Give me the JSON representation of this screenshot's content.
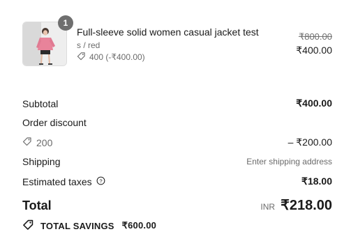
{
  "product": {
    "quantity": "1",
    "title": "Full-sleeve solid women casual jacket test",
    "variant": "s / red",
    "discount": "400 (-₹400.00)",
    "price_original": "₹800.00",
    "price": "₹400.00"
  },
  "summary": {
    "subtotal_label": "Subtotal",
    "subtotal_value": "₹400.00",
    "order_discount_label": "Order discount",
    "discount_code": "200",
    "discount_value": "– ₹200.00",
    "shipping_label": "Shipping",
    "shipping_value": "Enter shipping address",
    "taxes_label": "Estimated taxes",
    "taxes_value": "₹18.00",
    "total_label": "Total",
    "currency": "INR",
    "total_value": "₹218.00"
  },
  "savings": {
    "label": "TOTAL SAVINGS",
    "amount": "₹600.00"
  },
  "colors": {
    "text": "#1a1a1a",
    "muted": "#6b6b6b",
    "badge": "#6f6f6f",
    "jacket": "#e8839a"
  },
  "icons": [
    "tag-icon",
    "info-icon",
    "savings-tag-icon"
  ]
}
